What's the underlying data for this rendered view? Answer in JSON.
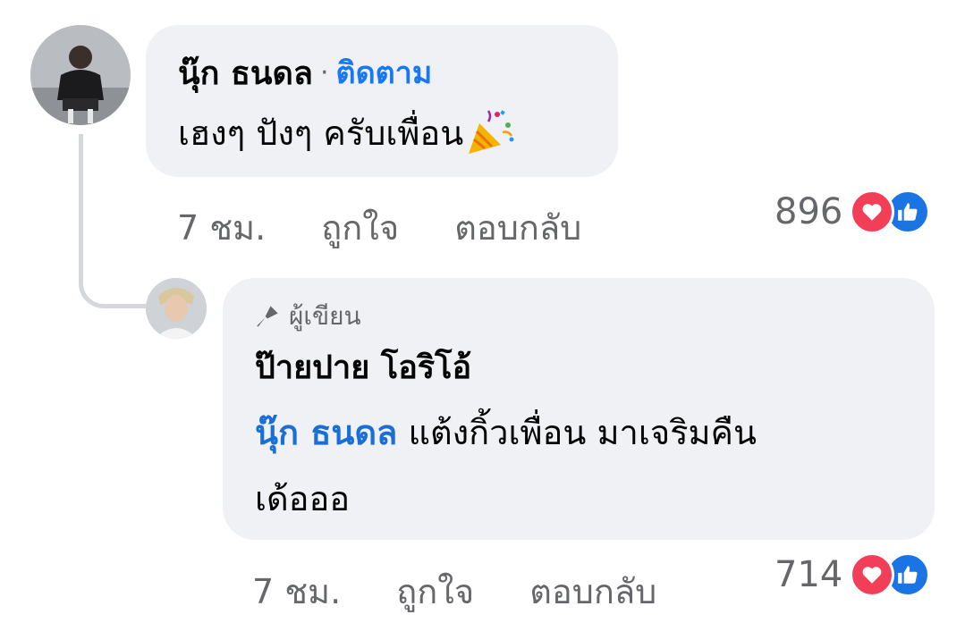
{
  "comment": {
    "author": "นุ๊ก ธนดล",
    "separator": "·",
    "follow_label": "ติดตาม",
    "text": "เฮงๆ ปังๆ ครับเพื่อน",
    "emoji_icon": "party-popper-icon",
    "time": "7 ชม.",
    "like_label": "ถูกใจ",
    "reply_label": "ตอบกลับ",
    "reaction_count": "896",
    "reactions": [
      "love",
      "like"
    ]
  },
  "reply": {
    "badge_label": "ผู้เขียน",
    "badge_icon": "microphone-icon",
    "author": "ป๊ายปาย โอริโอ้",
    "mention": "นุ๊ก ธนดล",
    "text_line1": "แต้งกิ้วเพื่อน มาเจริมคืน",
    "text_line2": "เด้อออ",
    "time": "7 ชม.",
    "like_label": "ถูกใจ",
    "reply_label": "ตอบกลับ",
    "reaction_count": "714",
    "reactions": [
      "love",
      "like"
    ]
  },
  "colors": {
    "bubble": "#eff1f4",
    "follow": "#1877f2",
    "mention": "#1a6ed8",
    "love": "#f33e58",
    "like": "#1b74e4",
    "muted": "#65676b"
  }
}
